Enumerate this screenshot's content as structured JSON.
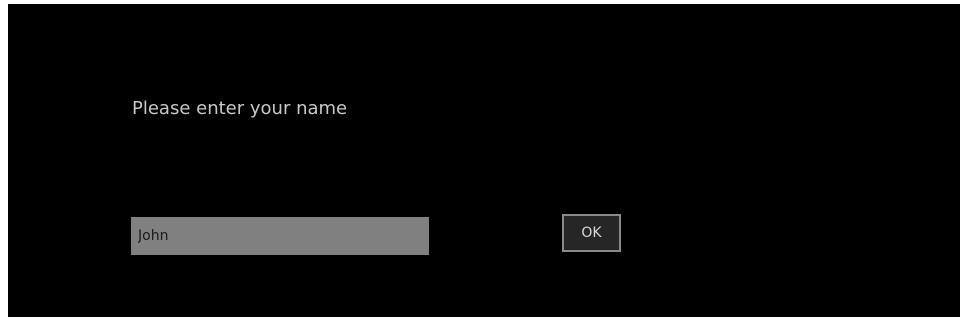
{
  "dialog": {
    "prompt": "Please enter your name",
    "name_input": {
      "value": "John"
    },
    "ok_label": "OK"
  },
  "colors": {
    "dialog_background": "#000000",
    "input_background": "#808080",
    "button_border": "#8a8a8a",
    "prompt_text": "#c8c8c8"
  }
}
